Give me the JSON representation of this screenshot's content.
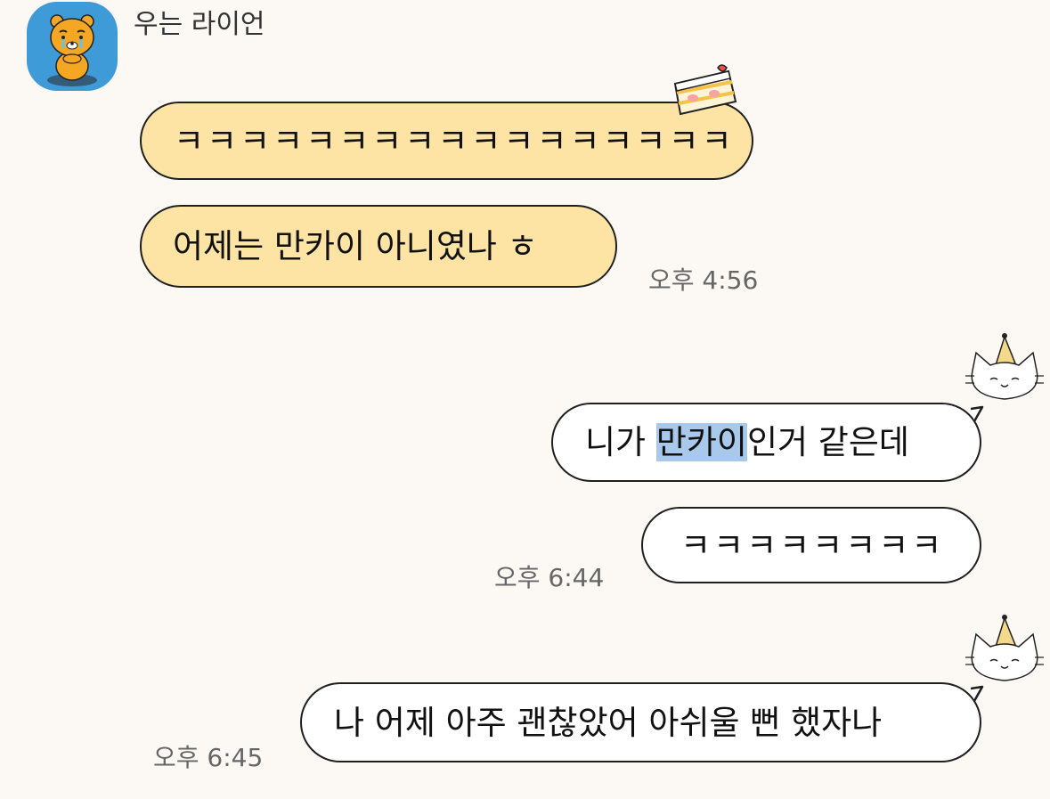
{
  "chat": {
    "sender": "우는 라이언",
    "messages": [
      {
        "text": "ㅋㅋㅋㅋㅋㅋㅋㅋㅋㅋㅋㅋㅋㅋㅋㅋㅋ",
        "direction": "incoming"
      },
      {
        "text": "어제는 만카이 아니였나 ㅎ",
        "direction": "incoming",
        "time": "오후 4:56"
      },
      {
        "text_before": "니가 ",
        "text_highlight": "만카이",
        "text_after": "인거 같은데",
        "direction": "outgoing"
      },
      {
        "text": "ㅋㅋㅋㅋㅋㅋㅋㅋ",
        "direction": "outgoing",
        "time": "오후 6:44"
      },
      {
        "text": "나 어제 아주 괜찮았어 아쉬울 뻔 했자나",
        "direction": "outgoing",
        "time": "오후 6:45"
      }
    ]
  },
  "colors": {
    "background": "#fcf8f4",
    "incoming_bubble": "#fde3a4",
    "outgoing_bubble": "#ffffff",
    "selection_highlight": "#a9c9ec",
    "avatar_background": "#3f9ad8"
  },
  "icons": [
    "crying-ryan-avatar-icon",
    "cake-sticker-icon",
    "party-hat-cat-sticker-icon"
  ]
}
